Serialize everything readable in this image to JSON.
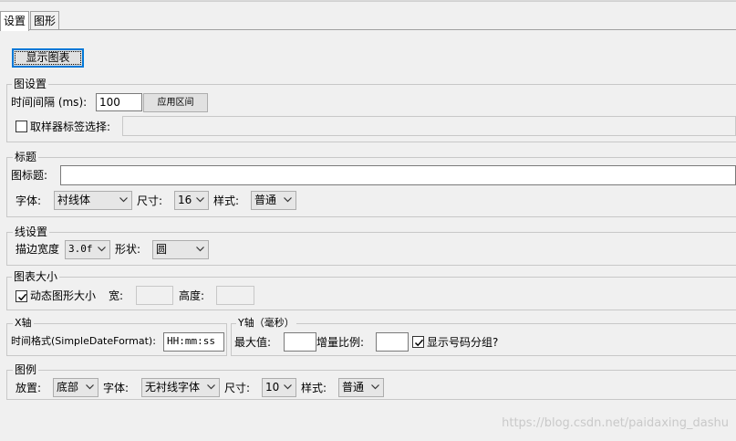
{
  "tabs": [
    {
      "label": "设置",
      "active": true
    },
    {
      "label": "图形",
      "active": false
    }
  ],
  "display_chart_button": "显示图表",
  "graph_settings": {
    "title": "图设置",
    "interval_label": "时间间隔 (ms):",
    "interval_value": "100",
    "apply_button": "应用区间",
    "sampler_checkbox_label": "取样器标签选择:",
    "sampler_checked": false,
    "sampler_value": ""
  },
  "title_group": {
    "title": "标题",
    "graph_title_label": "图标题:",
    "graph_title_value": "",
    "font_label": "字体:",
    "font_value": "衬线体",
    "size_label": "尺寸:",
    "size_value": "16",
    "style_label": "样式:",
    "style_value": "普通"
  },
  "line_settings": {
    "title": "线设置",
    "stroke_width_label": "描边宽度",
    "stroke_width_value": "3.0f",
    "shape_label": "形状:",
    "shape_value": "圆"
  },
  "chart_size": {
    "title": "图表大小",
    "dynamic_label": "动态图形大小",
    "dynamic_checked": true,
    "width_label": "宽:",
    "width_value": "",
    "height_label": "高度:",
    "height_value": ""
  },
  "x_axis": {
    "title": "X轴",
    "time_format_label": "时间格式(SimpleDateFormat):",
    "time_format_value": "HH:mm:ss"
  },
  "y_axis": {
    "title": "Y轴（毫秒）",
    "max_label": "最大值:",
    "max_value": "",
    "increment_label": "增量比例:",
    "increment_value": "",
    "grouping_label": "显示号码分组?",
    "grouping_checked": true
  },
  "legend": {
    "title": "图例",
    "placement_label": "放置:",
    "placement_value": "底部",
    "font_label": "字体:",
    "font_value": "无衬线字体",
    "size_label": "尺寸:",
    "size_value": "10",
    "style_label": "样式:",
    "style_value": "普通"
  },
  "watermark": "https://blog.csdn.net/paidaxing_dashu",
  "colors": {
    "background": "#f0f0f0",
    "focus_border": "#0078d7",
    "border": "#adadad"
  }
}
